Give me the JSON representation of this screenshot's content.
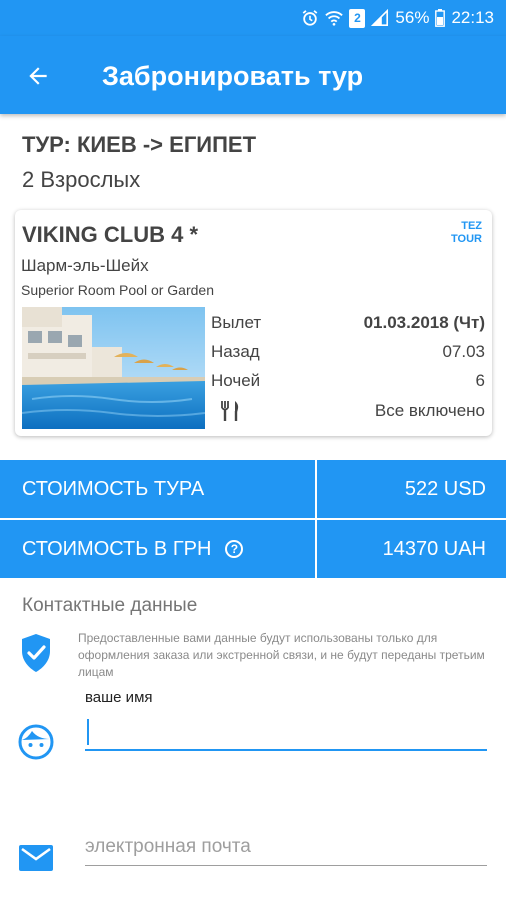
{
  "status_bar": {
    "battery_percent": "56%",
    "time": "22:13",
    "sim_badge": "2",
    "icons": [
      "alarm-icon",
      "wifi-icon",
      "sim-icon",
      "signal-icon",
      "battery-icon"
    ]
  },
  "app_bar": {
    "title": "Забронировать тур",
    "back_icon": "arrow-back-icon"
  },
  "tour": {
    "heading": "ТУР: КИЕВ -> ЕГИПЕТ",
    "passengers": "2 Взрослых"
  },
  "hotel": {
    "name": "VIKING CLUB 4 *",
    "operator_logo_line1": "TEZ",
    "operator_logo_line2": "TOUR",
    "location": "Шарм-эль-Шейх",
    "room_type": "Superior  Room Pool or Garden",
    "details": {
      "departure_label": "Вылет",
      "departure_value": "01.03.2018 (Чт)",
      "return_label": "Назад",
      "return_value": "07.03",
      "nights_label": "Ночей",
      "nights_value": "6",
      "meal_icon": "fork-knife-icon",
      "meal_value": "Все включено"
    }
  },
  "pricing": {
    "tour_cost_label": "СТОИМОСТЬ ТУРА",
    "tour_cost_value": "522 USD",
    "uah_cost_label": "СТОИМОСТЬ В ГРН",
    "uah_cost_value": "14370 UAH",
    "help_icon": "question-circle-icon"
  },
  "contacts": {
    "title": "Контактные данные",
    "privacy_note": "Предоставленные вами данные будут использованы только для оформления заказа или экстренной связи, и не будут переданы третьим лицам",
    "name_label": "ваше имя",
    "name_value": "",
    "email_placeholder": "электронная почта"
  },
  "colors": {
    "primary": "#2196f3",
    "text": "#444444",
    "hint": "#9e9e9e"
  }
}
